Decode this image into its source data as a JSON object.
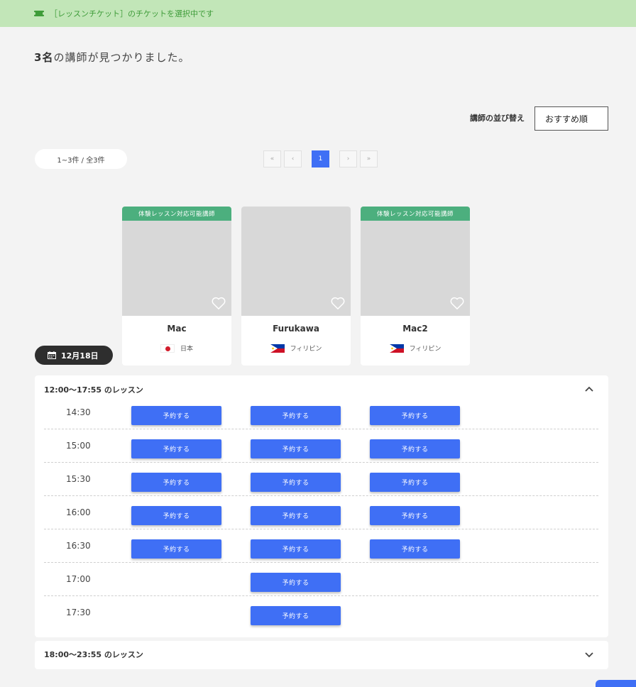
{
  "banner": {
    "text": "［レッスンチケット］のチケットを選択中です",
    "icon": "ticket-icon"
  },
  "result": {
    "count": "3名",
    "suffix": "の講師が見つかりました。"
  },
  "sort": {
    "label": "講師の並び替え",
    "selected": "おすすめ順"
  },
  "pagination": {
    "summary": "1~3件 / 全3件",
    "first": "«",
    "prev": "‹",
    "current": "1",
    "next": "›",
    "last": "»"
  },
  "teachers": [
    {
      "name": "Mac",
      "badge": "体験レッスン対応可能講師",
      "country": "日本",
      "flag": "jp"
    },
    {
      "name": "Furukawa",
      "badge": "",
      "country": "フィリピン",
      "flag": "ph"
    },
    {
      "name": "Mac2",
      "badge": "体験レッスン対応可能講師",
      "country": "フィリピン",
      "flag": "ph"
    }
  ],
  "date": "12月18日",
  "panels": [
    {
      "title": "12:00～17:55 のレッスン",
      "expanded": true,
      "slots": [
        {
          "time": "14:30",
          "available": [
            true,
            true,
            true
          ]
        },
        {
          "time": "15:00",
          "available": [
            true,
            true,
            true
          ]
        },
        {
          "time": "15:30",
          "available": [
            true,
            true,
            true
          ]
        },
        {
          "time": "16:00",
          "available": [
            true,
            true,
            true
          ]
        },
        {
          "time": "16:30",
          "available": [
            true,
            true,
            true
          ]
        },
        {
          "time": "17:00",
          "available": [
            false,
            true,
            false
          ]
        },
        {
          "time": "17:30",
          "available": [
            false,
            true,
            false
          ]
        }
      ]
    },
    {
      "title": "18:00～23:55 のレッスン",
      "expanded": false
    }
  ],
  "book_label": "予約する",
  "colors": {
    "accent": "#3f6ff5",
    "badge": "#4caf7e",
    "banner_bg": "#c2e6b8",
    "banner_text": "#3f9c3a"
  }
}
